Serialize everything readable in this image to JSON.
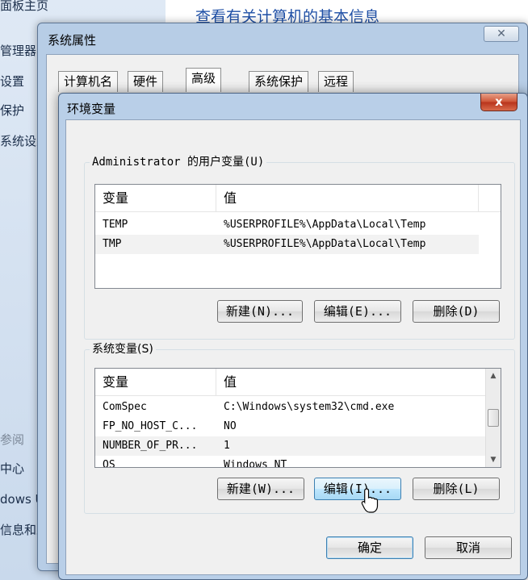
{
  "background": {
    "heading": "查看有关计算机的基本信息",
    "sidebar_items": [
      "面板主页",
      "管理器",
      "设置",
      "保护",
      "系统设置",
      "参阅",
      "中心",
      "dows U",
      "信息和工"
    ]
  },
  "system_properties": {
    "title": "系统属性",
    "close_label": "✕",
    "tabs": [
      "计算机名",
      "硬件",
      "高级",
      "系统保护",
      "远程"
    ]
  },
  "env_dialog": {
    "title": "环境变量",
    "close_label": "x",
    "user_group": {
      "label": "Administrator 的用户变量(U)",
      "columns": [
        "变量",
        "值"
      ],
      "rows": [
        {
          "name": "TEMP",
          "value": "%USERPROFILE%\\AppData\\Local\\Temp"
        },
        {
          "name": "TMP",
          "value": "%USERPROFILE%\\AppData\\Local\\Temp"
        }
      ],
      "buttons": {
        "new": "新建(N)...",
        "edit": "编辑(E)...",
        "delete": "删除(D)"
      }
    },
    "system_group": {
      "label": "系统变量(S)",
      "columns": [
        "变量",
        "值"
      ],
      "rows": [
        {
          "name": "ComSpec",
          "value": "C:\\Windows\\system32\\cmd.exe"
        },
        {
          "name": "FP_NO_HOST_C...",
          "value": "NO"
        },
        {
          "name": "NUMBER_OF_PR...",
          "value": "1"
        },
        {
          "name": "OS",
          "value": "Windows_NT"
        }
      ],
      "buttons": {
        "new": "新建(W)...",
        "edit": "编辑(I)...",
        "delete": "删除(L)"
      }
    },
    "ok_label": "确定",
    "cancel_label": "取消"
  }
}
